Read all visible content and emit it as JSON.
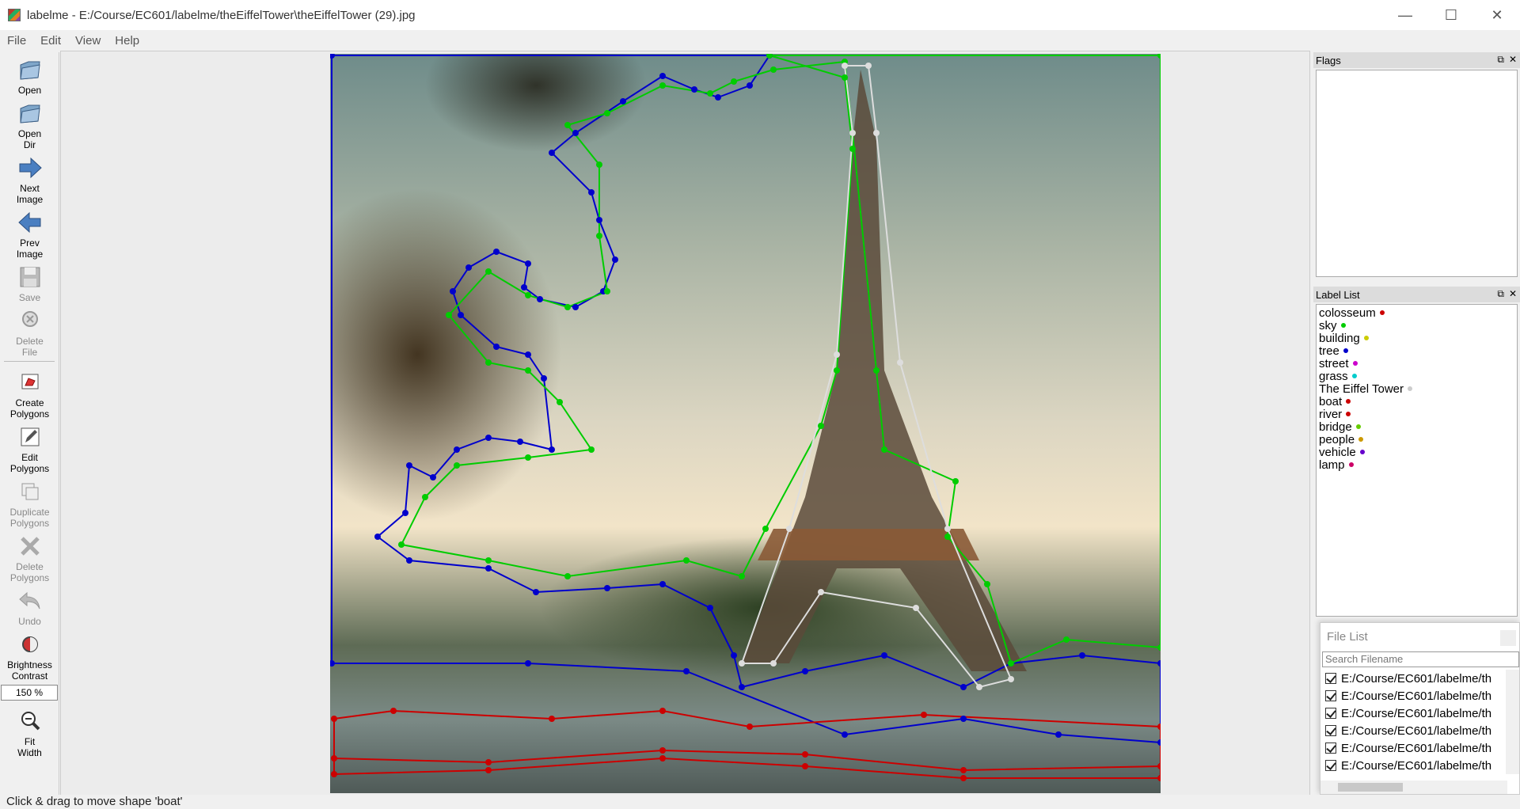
{
  "window": {
    "title": "labelme - E:/Course/EC601/labelme/theEiffelTower\\theEiffelTower (29).jpg",
    "controls": [
      "—",
      "☐",
      "✕"
    ]
  },
  "menu": [
    "File",
    "Edit",
    "View",
    "Help"
  ],
  "toolbar": {
    "open": "Open",
    "open_dir_1": "Open",
    "open_dir_2": "Dir",
    "next_1": "Next",
    "next_2": "Image",
    "prev_1": "Prev",
    "prev_2": "Image",
    "save": "Save",
    "delete_file_1": "Delete",
    "delete_file_2": "File",
    "create_1": "Create",
    "create_2": "Polygons",
    "edit_1": "Edit",
    "edit_2": "Polygons",
    "dup_1": "Duplicate",
    "dup_2": "Polygons",
    "delpoly_1": "Delete",
    "delpoly_2": "Polygons",
    "undo": "Undo",
    "bright_1": "Brightness",
    "bright_2": "Contrast",
    "zoom": "150 %",
    "fit_1": "Fit",
    "fit_2": "Width"
  },
  "flags": {
    "title": "Flags"
  },
  "label_list": {
    "title": "Label List",
    "items": [
      {
        "label": "colosseum",
        "color": "#cc0000"
      },
      {
        "label": "sky",
        "color": "#00cc00"
      },
      {
        "label": "building",
        "color": "#cccc00"
      },
      {
        "label": "tree",
        "color": "#0000cc"
      },
      {
        "label": "street",
        "color": "#cc00cc"
      },
      {
        "label": "grass",
        "color": "#00cccc"
      },
      {
        "label": "The Eiffel Tower",
        "color": "#cccccc"
      },
      {
        "label": "boat",
        "color": "#cc0000"
      },
      {
        "label": "river",
        "color": "#cc0000"
      },
      {
        "label": "bridge",
        "color": "#66cc00"
      },
      {
        "label": "people",
        "color": "#cc9900"
      },
      {
        "label": "vehicle",
        "color": "#6600cc"
      },
      {
        "label": "lamp",
        "color": "#cc0066"
      }
    ]
  },
  "file_list": {
    "title": "File List",
    "search_placeholder": "Search Filename",
    "files": [
      "E:/Course/EC601/labelme/th",
      "E:/Course/EC601/labelme/th",
      "E:/Course/EC601/labelme/th",
      "E:/Course/EC601/labelme/th",
      "E:/Course/EC601/labelme/th",
      "E:/Course/EC601/labelme/th"
    ]
  },
  "status": "Click & drag to move shape 'boat'",
  "colors": {
    "tree": "#0000cc",
    "sky": "#00cc00",
    "boat": "#cc0000",
    "tower": "#dddddd"
  }
}
